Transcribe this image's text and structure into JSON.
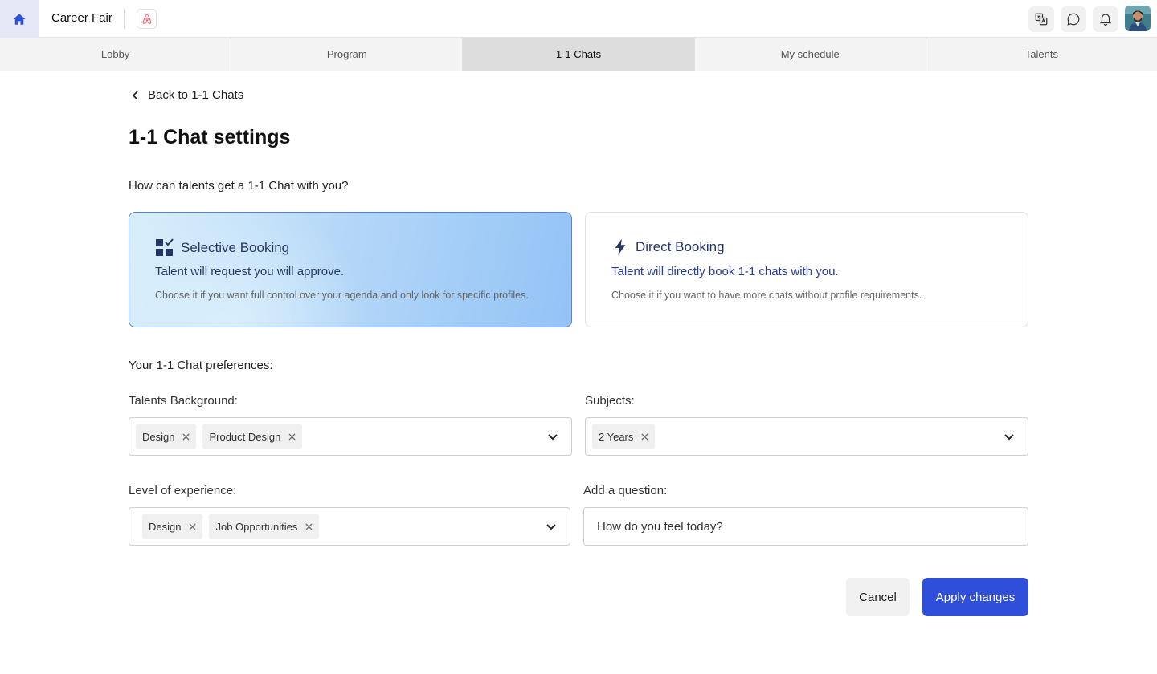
{
  "header": {
    "app_title": "Career Fair",
    "icons": [
      "home-icon",
      "brand-logo-icon",
      "translate-icon",
      "chat-icon",
      "bell-icon"
    ]
  },
  "tabs": [
    {
      "label": "Lobby"
    },
    {
      "label": "Program"
    },
    {
      "label": "1-1 Chats",
      "active": true
    },
    {
      "label": "My schedule"
    },
    {
      "label": "Talents"
    }
  ],
  "main": {
    "back_label": "Back to 1-1 Chats",
    "title": "1-1 Chat settings",
    "question": "How can talents get a 1-1 Chat with you?",
    "options": [
      {
        "title": "Selective Booking",
        "subtitle": "Talent will request you will approve.",
        "description": "Choose it if you want full control over your agenda and only look for specific profiles.",
        "selected": true
      },
      {
        "title": "Direct Booking",
        "subtitle": "Talent will directly book 1-1 chats with you.",
        "description": "Choose it if you want to have more chats without profile requirements.",
        "selected": false
      }
    ],
    "preferences_label": "Your 1-1 Chat preferences:",
    "fields": {
      "background": {
        "label": "Talents Background:",
        "chips": [
          "Design",
          "Product Design"
        ]
      },
      "subjects": {
        "label": "Subjects:",
        "chips": [
          "2 Years"
        ]
      },
      "experience": {
        "label": "Level of experience:",
        "chips": [
          "Design",
          "Job Opportunities"
        ]
      },
      "question": {
        "label": "Add a question:",
        "value": "How do you feel today?"
      }
    },
    "actions": {
      "cancel": "Cancel",
      "apply": "Apply changes"
    }
  },
  "colors": {
    "accent": "#2f4fdb",
    "selected_card_border": "#5b7fe0",
    "home_bg": "#e6e8f8",
    "brand_logo": "#ff5a5f"
  }
}
